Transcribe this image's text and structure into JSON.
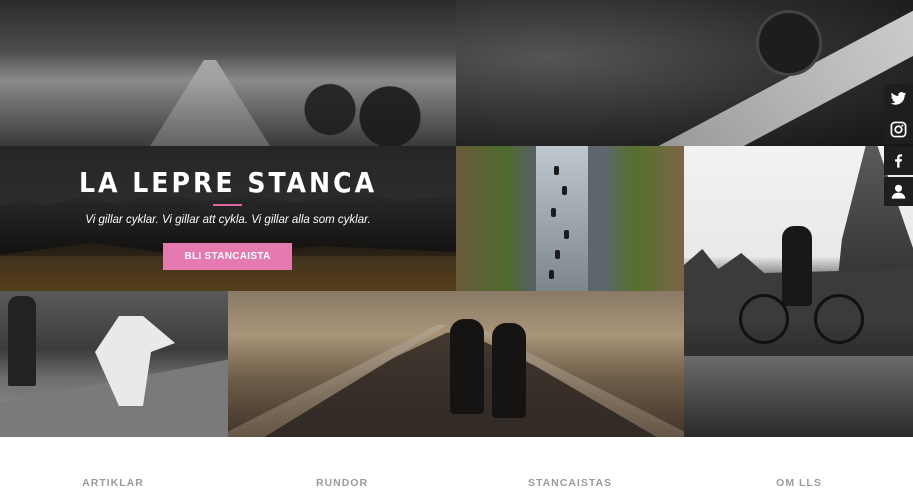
{
  "hero": {
    "title": "LA LEPRE STANCA",
    "tagline": "Vi gillar cyklar. Vi gillar att cykla. Vi gillar alla som cyklar.",
    "cta_label": "BLI STANCAISTA"
  },
  "colors": {
    "accent": "#e57ab1",
    "hero_background": "#2a2a2c",
    "social_background": "#1e1e1e",
    "nav_text": "#9b9b9b"
  },
  "social": [
    "twitter-icon",
    "instagram-icon",
    "facebook-icon",
    "user-icon"
  ],
  "nav": {
    "items": [
      {
        "label": "ARTIKLAR"
      },
      {
        "label": "RUNDOR"
      },
      {
        "label": "STANCAISTAS"
      },
      {
        "label": "OM LLS"
      }
    ]
  }
}
